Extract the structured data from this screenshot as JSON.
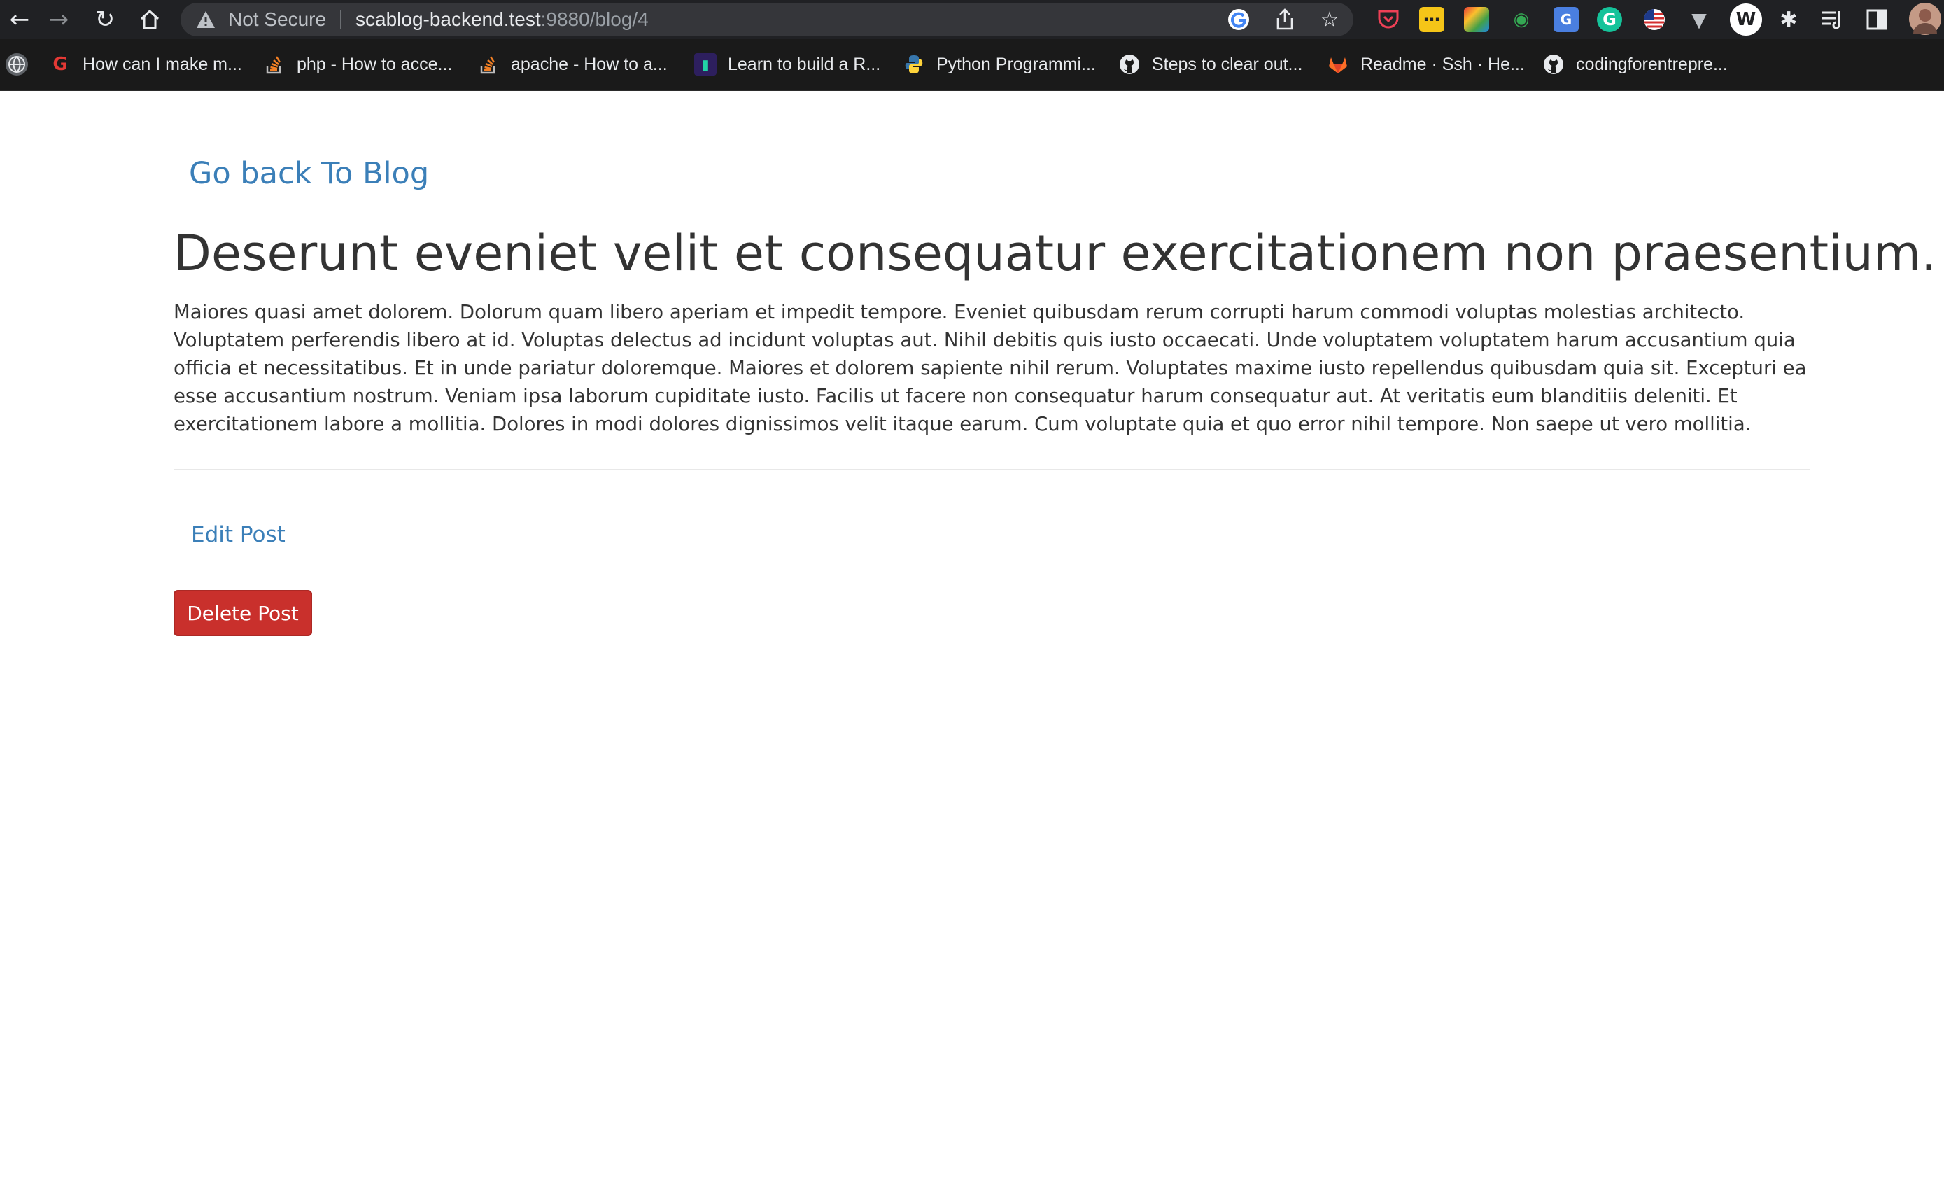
{
  "browser": {
    "security_label": "Not Secure",
    "url_host": "scablog-backend.test",
    "url_rest": ":9880/blog/4",
    "bookmarks": [
      {
        "label": "How can I make m...",
        "icon": "g-icon"
      },
      {
        "label": "php - How to acce...",
        "icon": "stackoverflow-icon"
      },
      {
        "label": "apache - How to a...",
        "icon": "stackoverflow-icon"
      },
      {
        "label": "Learn to build a R...",
        "icon": "book-icon"
      },
      {
        "label": "Python Programmi...",
        "icon": "python-icon"
      },
      {
        "label": "Steps to clear out...",
        "icon": "github-icon"
      },
      {
        "label": "Readme · Ssh · He...",
        "icon": "gitlab-icon"
      },
      {
        "label": "codingforentrepre...",
        "icon": "github-icon"
      }
    ]
  },
  "page": {
    "back_link": "Go back To Blog",
    "title": "Deserunt eveniet velit et consequatur exercitationem non praesentium.",
    "body": "Maiores quasi amet dolorem. Dolorum quam libero aperiam et impedit tempore. Eveniet quibusdam rerum corrupti harum commodi voluptas molestias architecto. Voluptatem perferendis libero at id. Voluptas delectus ad incidunt voluptas aut. Nihil debitis quis iusto occaecati. Unde voluptatem voluptatem harum accusantium quia officia et necessitatibus. Et in unde pariatur doloremque. Maiores et dolorem sapiente nihil rerum. Voluptates maxime iusto repellendus quibusdam quia sit. Excepturi ea esse accusantium nostrum. Veniam ipsa laborum cupiditate iusto. Facilis ut facere non consequatur harum consequatur aut. At veritatis eum blanditiis deleniti. Et exercitationem labore a mollitia. Dolores in modi dolores dignissimos velit itaque earum. Cum voluptate quia et quo error nihil tempore. Non saepe ut vero mollitia.",
    "edit_link": "Edit Post",
    "delete_button": "Delete Post"
  },
  "colors": {
    "link": "#3b7fb8",
    "danger": "#c9302c",
    "text": "#333333",
    "toolbar_bg": "#202124",
    "bookmarks_bg": "#1a1a1a"
  }
}
